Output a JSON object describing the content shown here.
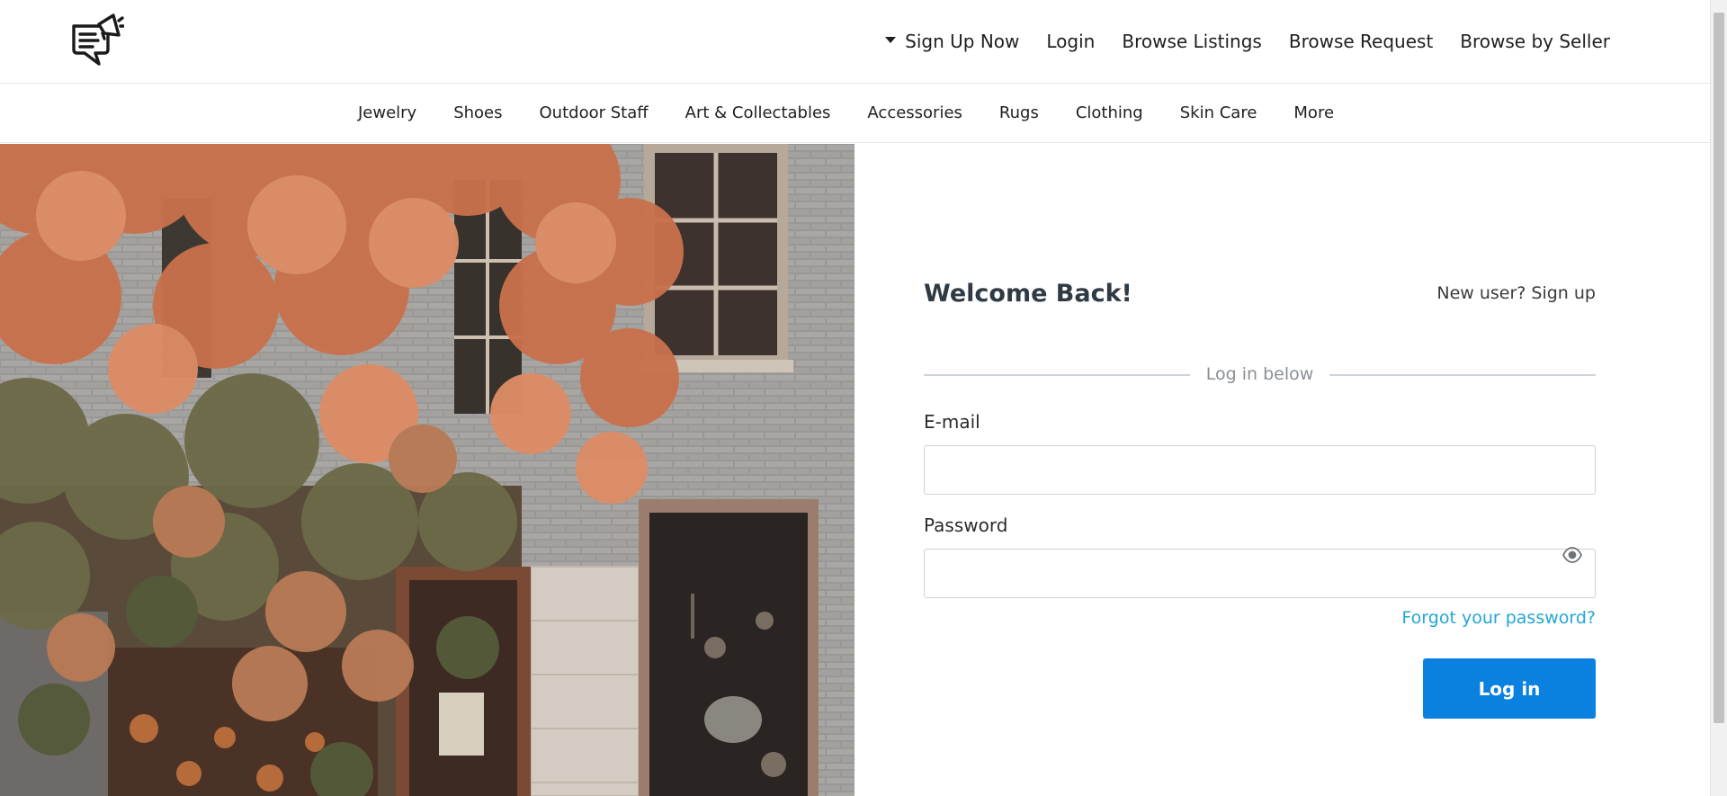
{
  "header": {
    "logo_icon": "megaphone-chat-icon",
    "nav": {
      "signup_label": "Sign Up Now",
      "login_label": "Login",
      "browse_listings_label": "Browse Listings",
      "browse_request_label": "Browse Request",
      "browse_seller_label": "Browse by Seller"
    }
  },
  "categories": [
    "Jewelry",
    "Shoes",
    "Outdoor Staff",
    "Art & Collectables",
    "Accessories",
    "Rugs",
    "Clothing",
    "Skin Care",
    "More"
  ],
  "login": {
    "title": "Welcome Back!",
    "new_user_link": "New user? Sign up",
    "divider_text": "Log in below",
    "email_label": "E-mail",
    "email_value": "",
    "password_label": "Password",
    "password_value": "",
    "show_password_icon": "eye-icon",
    "forgot_link": "Forgot your password?",
    "submit_label": "Log in"
  },
  "colors": {
    "accent": "#0a80e0",
    "link": "#22a6d6",
    "heading": "#2f3a44"
  }
}
